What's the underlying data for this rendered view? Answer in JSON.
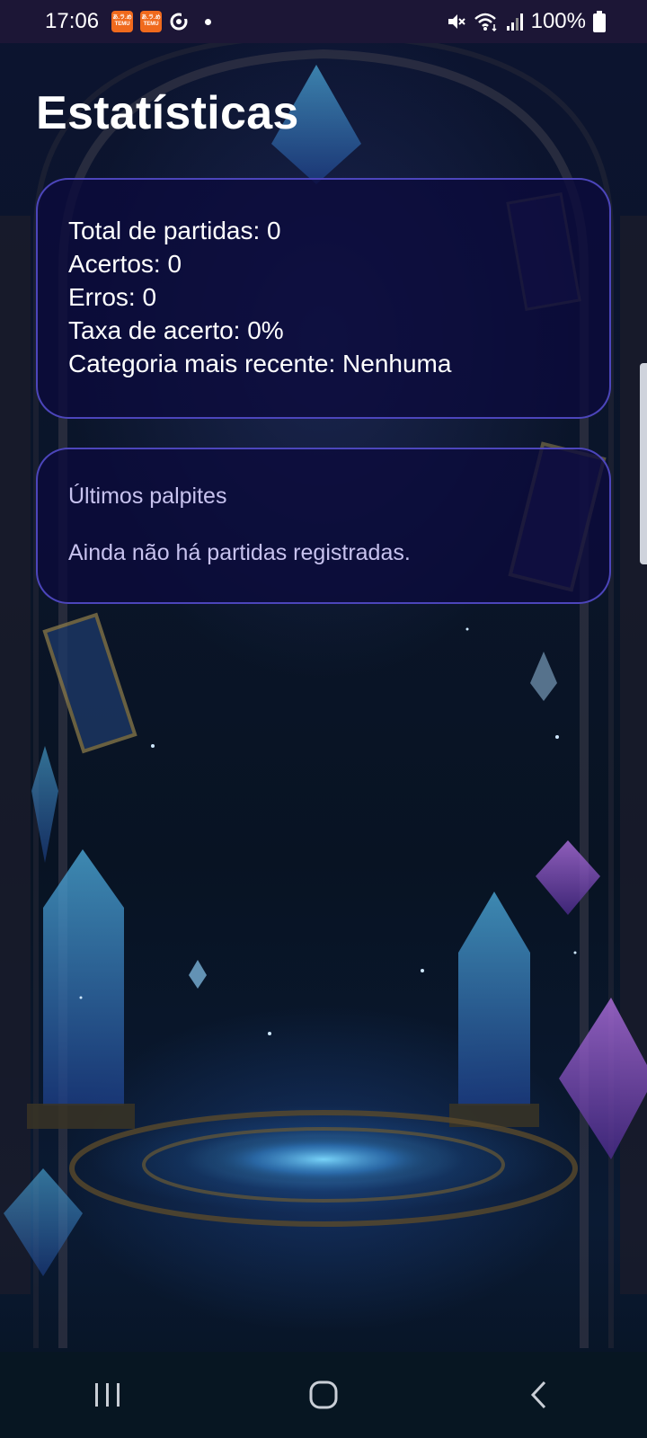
{
  "status_bar": {
    "time": "17:06",
    "notification_icons": [
      "temu-icon",
      "temu-icon",
      "sync-ring-icon",
      "dot-icon"
    ],
    "temu_label_top": "あ.ラ.め",
    "temu_label_bottom": "TEMU",
    "battery": "100%",
    "system_icons": [
      "mute-icon",
      "wifi-icon",
      "signal-icon",
      "battery-icon"
    ]
  },
  "header": {
    "title": "Estatísticas"
  },
  "stats": {
    "total_label": "Total de partidas: 0",
    "hits_label": "Acertos: 0",
    "errors_label": "Erros: 0",
    "rate_label": "Taxa de acerto: 0%",
    "recent_category_label": "Categoria mais recente: Nenhuma"
  },
  "guesses": {
    "title": "Últimos palpites",
    "empty_message": "Ainda não há partidas registradas."
  },
  "nav_bar": {
    "buttons": [
      "recent-apps-icon",
      "home-icon",
      "back-icon"
    ]
  },
  "colors": {
    "accent_border": "#5850d2",
    "card_background": "#0c0a3c",
    "status_bar": "#1c1636",
    "temu_orange": "#f06a1d"
  }
}
